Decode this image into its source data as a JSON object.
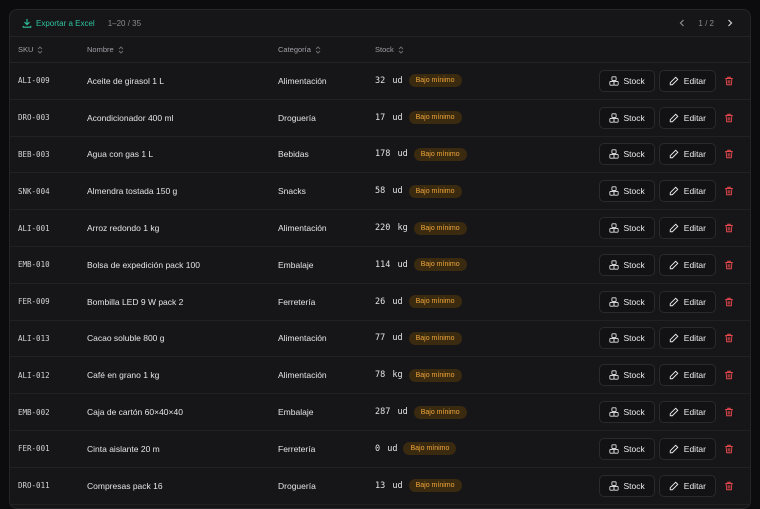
{
  "toolbar": {
    "export_label": "Exportar a Excel",
    "range": "1–20 / 35",
    "page": "1 / 2"
  },
  "columns": {
    "sku": "SKU",
    "name": "Nombre",
    "category": "Categoría",
    "stock": "Stock"
  },
  "actions": {
    "stock_label": "Stock",
    "edit_label": "Editar"
  },
  "colors": {
    "accent": "#2fc3a0",
    "warning_bg": "#3a2a10",
    "warning_text": "#f0a63a",
    "danger": "#e5484d"
  },
  "rows": [
    {
      "sku": "ALI-009",
      "name": "Aceite de girasol 1 L",
      "category": "Alimentación",
      "qty": "32 ud",
      "badge": "Bajo mínimo"
    },
    {
      "sku": "DRO-003",
      "name": "Acondicionador 400 ml",
      "category": "Droguería",
      "qty": "17 ud",
      "badge": "Bajo mínimo"
    },
    {
      "sku": "BEB-003",
      "name": "Agua con gas 1 L",
      "category": "Bebidas",
      "qty": "178 ud",
      "badge": "Bajo mínimo"
    },
    {
      "sku": "SNK-004",
      "name": "Almendra tostada 150 g",
      "category": "Snacks",
      "qty": "58 ud",
      "badge": "Bajo mínimo"
    },
    {
      "sku": "ALI-001",
      "name": "Arroz redondo 1 kg",
      "category": "Alimentación",
      "qty": "220 kg",
      "badge": "Bajo mínimo"
    },
    {
      "sku": "EMB-010",
      "name": "Bolsa de expedición pack 100",
      "category": "Embalaje",
      "qty": "114 ud",
      "badge": "Bajo mínimo"
    },
    {
      "sku": "FER-009",
      "name": "Bombilla LED 9 W pack 2",
      "category": "Ferretería",
      "qty": "26 ud",
      "badge": "Bajo mínimo"
    },
    {
      "sku": "ALI-013",
      "name": "Cacao soluble 800 g",
      "category": "Alimentación",
      "qty": "77 ud",
      "badge": "Bajo mínimo"
    },
    {
      "sku": "ALI-012",
      "name": "Café en grano 1 kg",
      "category": "Alimentación",
      "qty": "78 kg",
      "badge": "Bajo mínimo"
    },
    {
      "sku": "EMB-002",
      "name": "Caja de cartón 60×40×40",
      "category": "Embalaje",
      "qty": "287 ud",
      "badge": "Bajo mínimo"
    },
    {
      "sku": "FER-001",
      "name": "Cinta aislante 20 m",
      "category": "Ferretería",
      "qty": "0 ud",
      "badge": "Bajo mínimo"
    },
    {
      "sku": "DRO-011",
      "name": "Compresas pack 16",
      "category": "Droguería",
      "qty": "13 ud",
      "badge": "Bajo mínimo"
    }
  ]
}
